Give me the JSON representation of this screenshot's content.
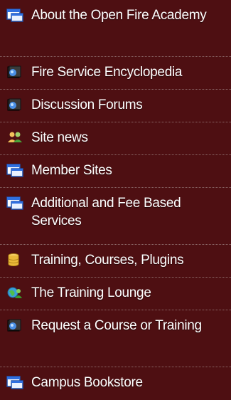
{
  "menu": {
    "items": [
      {
        "label": "About the Open Fire Academy",
        "icon": "window-icon"
      },
      {
        "label": "Fire Service Encyclopedia",
        "icon": "book-icon"
      },
      {
        "label": "Discussion Forums",
        "icon": "book-icon"
      },
      {
        "label": "Site news",
        "icon": "users-icon"
      },
      {
        "label": "Member Sites",
        "icon": "window-icon"
      },
      {
        "label": "Additional and Fee Based Services",
        "icon": "window-icon"
      },
      {
        "label": "Training, Courses, Plugins",
        "icon": "database-icon"
      },
      {
        "label": "The Training Lounge",
        "icon": "globe-people-icon"
      },
      {
        "label": "Request a Course or Training",
        "icon": "book-icon"
      },
      {
        "label": "Campus Bookstore",
        "icon": "window-icon"
      }
    ]
  }
}
